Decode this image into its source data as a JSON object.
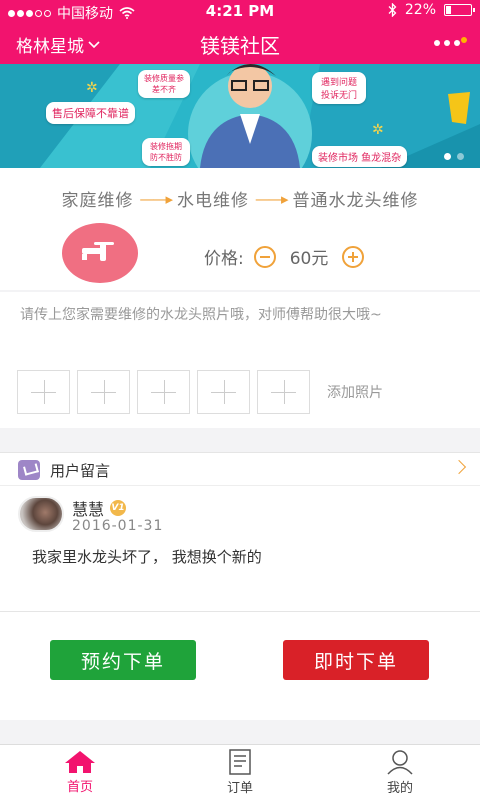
{
  "status_bar": {
    "carrier": "中国移动",
    "time": "4:21 PM",
    "battery_text": "22%",
    "battery_level": 0.22
  },
  "header": {
    "city": "格林星城",
    "title": "镁镁社区"
  },
  "banner": {
    "tags": [
      "售后保障不靠谱",
      "装修质量参差不齐",
      "遇到问题投诉无门",
      "装修拖期防不胜防",
      "装修市场 鱼龙混杂"
    ],
    "colors": {
      "bg": "#2ab6c9",
      "accent": "#e0245e"
    }
  },
  "service": {
    "path": [
      "家庭维修",
      "水电维修",
      "普通水龙头维修"
    ],
    "price_label": "价格:",
    "price_value": "60元"
  },
  "upload": {
    "hint": "请传上您家需要维修的水龙头照片哦，对师傅帮助很大哦~",
    "add_label": "添加照片",
    "slots": 5
  },
  "messages": {
    "title": "用户留言",
    "items": [
      {
        "name": "慧慧",
        "badge": "V1",
        "date": "2016-01-31",
        "text": "我家里水龙头坏了， 我想换个新的"
      }
    ]
  },
  "actions": {
    "book_label": "预约下单",
    "instant_label": "即时下单",
    "colors": {
      "book": "#1fa33a",
      "instant": "#d92128"
    }
  },
  "tabs": [
    {
      "label": "首页",
      "icon": "home-icon",
      "active": true
    },
    {
      "label": "订单",
      "icon": "order-icon",
      "active": false
    },
    {
      "label": "我的",
      "icon": "profile-icon",
      "active": false
    }
  ],
  "theme": {
    "primary": "#f2136e",
    "accent": "#f0a23a"
  }
}
